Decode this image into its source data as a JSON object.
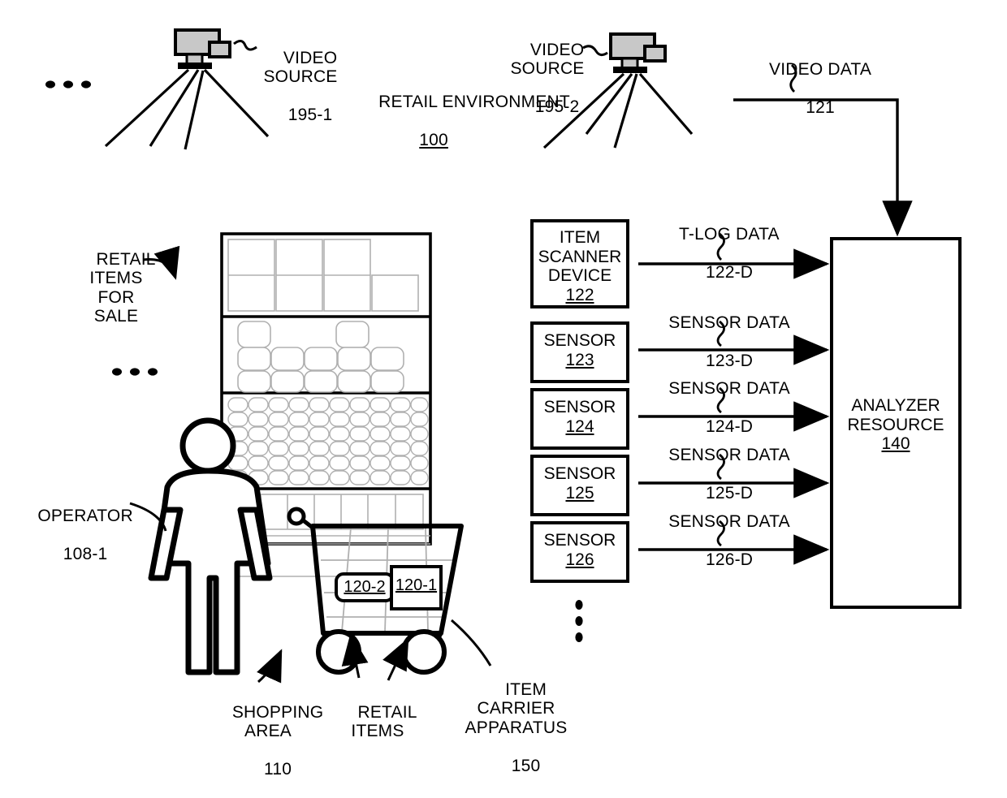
{
  "figure": {
    "title": "RETAIL ENVIRONMENT",
    "title_ref": "100"
  },
  "cameras": [
    {
      "name": "VIDEO\nSOURCE",
      "ref": "195-1",
      "icon": "video-camera-icon"
    },
    {
      "name": "VIDEO\nSOURCE",
      "ref": "195-2",
      "icon": "video-camera-icon"
    }
  ],
  "video_data": {
    "label": "VIDEO DATA",
    "ref": "121"
  },
  "store": {
    "retail_items_for_sale": "RETAIL\nITEMS\nFOR\nSALE",
    "operator": {
      "label": "OPERATOR",
      "ref": "108-1"
    },
    "shopping_area": {
      "label": "SHOPPING\nAREA",
      "ref": "110"
    },
    "retail_items": "RETAIL\nITEMS",
    "item_carrier": {
      "label": "ITEM\nCARRIER\nAPPARATUS",
      "ref": "150"
    },
    "cart_items": [
      {
        "ref": "120-2",
        "shape": "rounded"
      },
      {
        "ref": "120-1",
        "shape": "square"
      }
    ],
    "ellipsis_left_top": "...",
    "ellipsis_left_mid": "..."
  },
  "devices": [
    {
      "name": "ITEM\nSCANNER\nDEVICE",
      "ref": "122",
      "signal": "T-LOG DATA",
      "signal_ref": "122-D"
    },
    {
      "name": "SENSOR",
      "ref": "123",
      "signal": "SENSOR DATA",
      "signal_ref": "123-D"
    },
    {
      "name": "SENSOR",
      "ref": "124",
      "signal": "SENSOR DATA",
      "signal_ref": "124-D"
    },
    {
      "name": "SENSOR",
      "ref": "125",
      "signal": "SENSOR DATA",
      "signal_ref": "125-D"
    },
    {
      "name": "SENSOR",
      "ref": "126",
      "signal": "SENSOR DATA",
      "signal_ref": "126-D"
    }
  ],
  "devices_ellipsis": "vertical-ellipsis",
  "analyzer": {
    "name": "ANALYZER\nRESOURCE",
    "ref": "140"
  },
  "colors": {
    "line": "#000000",
    "camera_body": "#c8c8c8",
    "fixture": "#b0b0b0"
  }
}
